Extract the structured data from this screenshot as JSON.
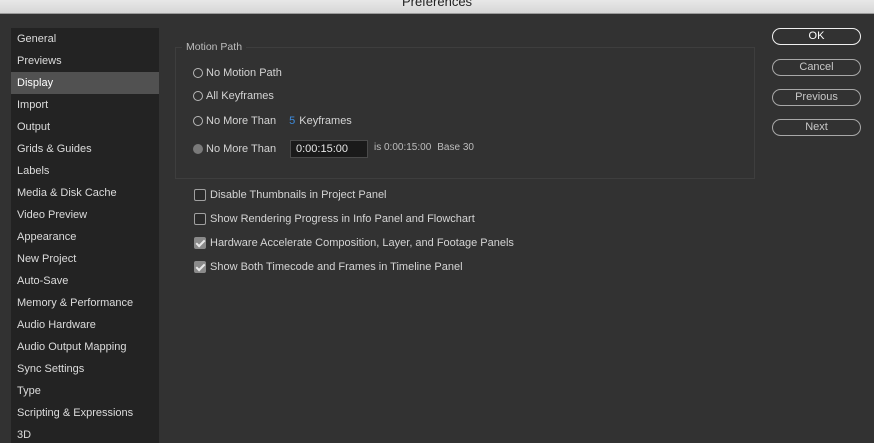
{
  "window": {
    "title": "Preferences"
  },
  "sidebar": {
    "items": [
      {
        "label": "General"
      },
      {
        "label": "Previews"
      },
      {
        "label": "Display",
        "selected": true
      },
      {
        "label": "Import"
      },
      {
        "label": "Output"
      },
      {
        "label": "Grids & Guides"
      },
      {
        "label": "Labels"
      },
      {
        "label": "Media & Disk Cache"
      },
      {
        "label": "Video Preview"
      },
      {
        "label": "Appearance"
      },
      {
        "label": "New Project"
      },
      {
        "label": "Auto-Save"
      },
      {
        "label": "Memory & Performance"
      },
      {
        "label": "Audio Hardware"
      },
      {
        "label": "Audio Output Mapping"
      },
      {
        "label": "Sync Settings"
      },
      {
        "label": "Type"
      },
      {
        "label": "Scripting & Expressions"
      },
      {
        "label": "3D"
      }
    ]
  },
  "motion_path": {
    "title": "Motion Path",
    "options": {
      "none": "No Motion Path",
      "all": "All Keyframes",
      "keyframes": "No More Than",
      "time": "No More Than"
    },
    "keyframe_count": "5",
    "keyframe_suffix": "Keyframes",
    "time_value": "0:00:15:00",
    "time_equivalent": "is 0:00:15:00",
    "time_base": "Base 30"
  },
  "checkboxes": [
    {
      "label": "Disable Thumbnails in Project Panel",
      "checked": false
    },
    {
      "label": "Show Rendering Progress in Info Panel and Flowchart",
      "checked": false
    },
    {
      "label": "Hardware Accelerate Composition, Layer, and Footage Panels",
      "checked": true
    },
    {
      "label": "Show Both Timecode and Frames in Timeline Panel",
      "checked": true
    }
  ],
  "buttons": {
    "ok": "OK",
    "cancel": "Cancel",
    "previous": "Previous",
    "next": "Next"
  }
}
